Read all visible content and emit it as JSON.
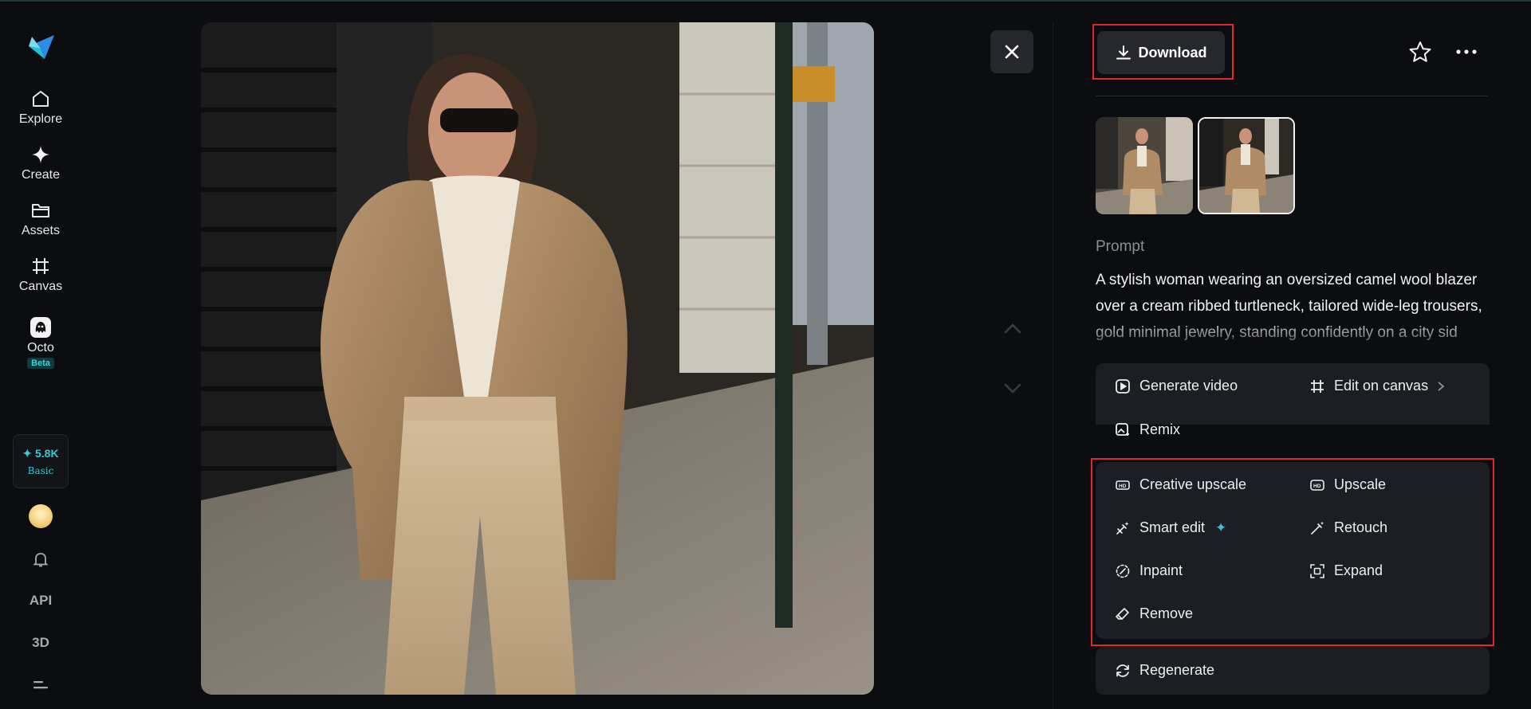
{
  "sidebar": {
    "items": [
      {
        "label": "Explore",
        "icon": "home-icon"
      },
      {
        "label": "Create",
        "icon": "sparkle-icon"
      },
      {
        "label": "Assets",
        "icon": "folder-icon"
      },
      {
        "label": "Canvas",
        "icon": "canvas-frame-icon"
      },
      {
        "label": "Octo",
        "icon": "octo-icon",
        "badge": "Beta"
      }
    ],
    "credits": {
      "amount": "✦ 5.8K",
      "plan": "Basic"
    },
    "api_label": "API",
    "threed_label": "3D"
  },
  "viewer": {
    "image_alt": "A stylish woman in a camel wool blazer and cream turtleneck on a city sidewalk"
  },
  "panel": {
    "download_label": "Download",
    "prompt_label": "Prompt",
    "prompt_text": "A stylish woman wearing an oversized camel wool blazer over a cream ribbed turtleneck, tailored wide-leg trousers, gold minimal jewelry, standing confidently on a city sid",
    "primary_actions": {
      "generate_video": "Generate video",
      "edit_on_canvas": "Edit on canvas",
      "remix": "Remix"
    },
    "edit_actions": {
      "creative_upscale": "Creative upscale",
      "upscale": "Upscale",
      "smart_edit": "Smart edit",
      "retouch": "Retouch",
      "inpaint": "Inpaint",
      "expand": "Expand",
      "remove": "Remove"
    },
    "regenerate_label": "Regenerate"
  },
  "colors": {
    "accent": "#2fc4d6",
    "highlight": "#e0282a",
    "background": "#0c0d10",
    "card": "#1c1e23"
  }
}
